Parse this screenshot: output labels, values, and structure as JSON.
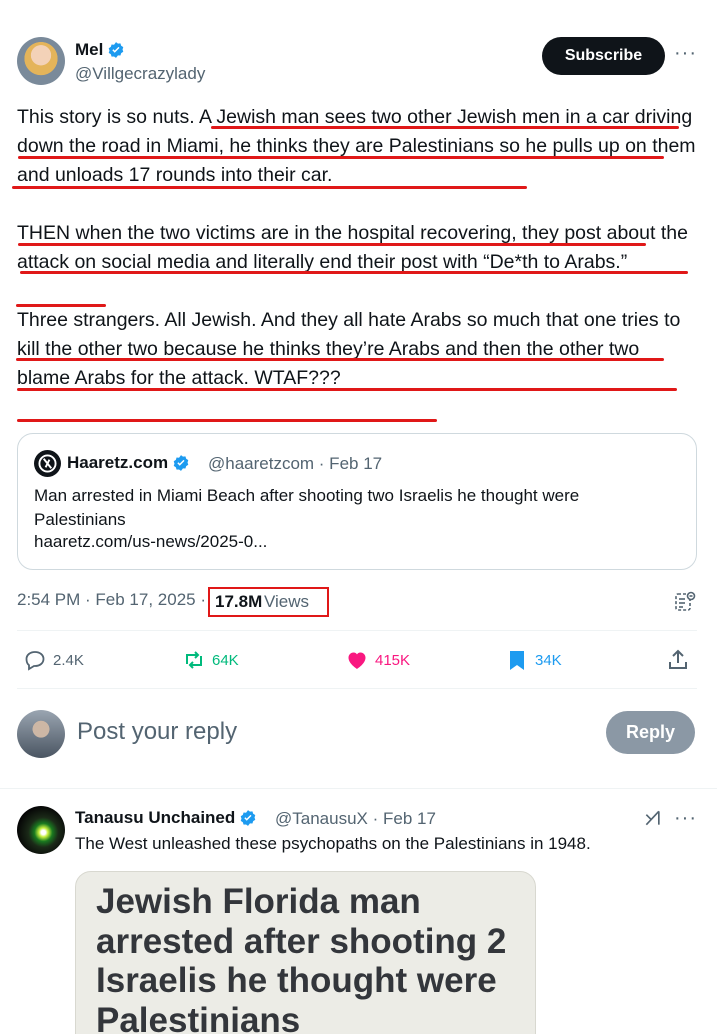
{
  "post": {
    "author_name": "Mel",
    "author_handle": "@Villgecrazylady",
    "subscribe_label": "Subscribe",
    "more_label": "···",
    "body_paragraphs": [
      "This story is so nuts. A Jewish man sees two other Jewish men in a car driving down the road in Miami, he thinks they are Palestinians so he pulls up on them and unloads 17 rounds into their car.",
      "THEN when the two victims are in the hospital recovering, they post about the attack on social media and literally end their post with “De*th to Arabs.”",
      "Three strangers. All Jewish. And they all hate Arabs so much that one tries to kill the other two because he thinks they’re Arabs and then the other two blame Arabs for the attack. WTAF???"
    ],
    "underline_color": "#e01818"
  },
  "quote": {
    "name": "Haaretz.com",
    "meta": "@haaretzcom · Feb 17",
    "text": "Man arrested in Miami Beach after shooting two Israelis he thought were Palestinians",
    "link": "haaretz.com/us-news/2025-0..."
  },
  "meta_row": {
    "timestamp": "2:54 PM · Feb 17, 2025 ·",
    "views_count": "17.8M",
    "views_label": "Views"
  },
  "actions": {
    "replies": "2.4K",
    "reposts": "64K",
    "likes": "415K",
    "bookmarks": "34K"
  },
  "composer": {
    "placeholder": "Post your reply",
    "reply_label": "Reply"
  },
  "reply_tweet": {
    "name": "Tanausu Unchained",
    "meta": "@TanausuX · Feb 17",
    "more_label": "···",
    "text": "The West unleashed these psychopaths on the Palestinians in 1948.",
    "image_headline": "Jewish Florida man arrested after shooting 2 Israelis he thought were Palestinians"
  },
  "colors": {
    "verified": "#1d9bf0",
    "repost": "#00ba7c",
    "like": "#f91880",
    "bookmark": "#1d9bf0",
    "reply_icon": "#1d9bf0",
    "secondary_text": "#536471"
  }
}
